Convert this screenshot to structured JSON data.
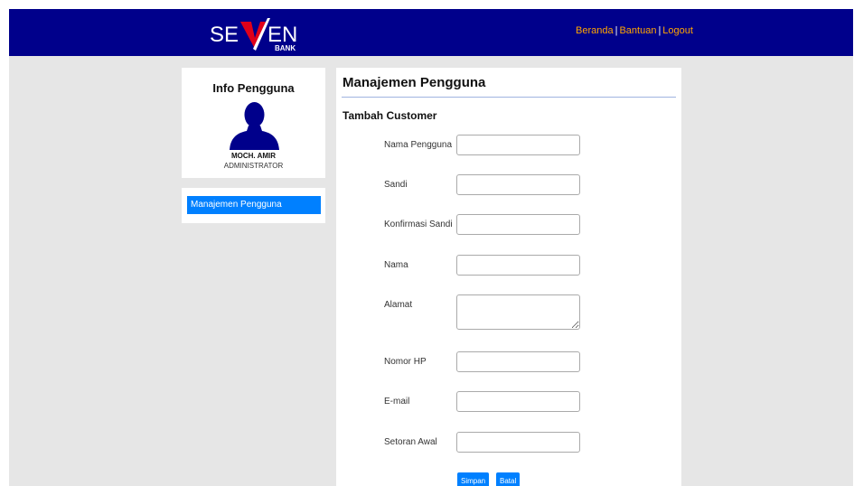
{
  "brand": {
    "logo_text_left": "SE",
    "logo_text_right": "EN",
    "logo_sub": "BANK",
    "header_bg": "#00008b",
    "logo_accent": "#e0001a",
    "link_color": "#ffa500"
  },
  "nav": {
    "items": [
      {
        "label": "Beranda"
      },
      {
        "label": "Bantuan"
      },
      {
        "label": "Logout"
      }
    ],
    "separator": "|"
  },
  "user_panel": {
    "title": "Info Pengguna",
    "avatar_icon": "user-silhouette-icon",
    "name": "MOCH. AMIR",
    "role": "ADMINISTRATOR"
  },
  "menu": {
    "items": [
      {
        "label": "Manajemen Pengguna",
        "active": true
      }
    ]
  },
  "main": {
    "title": "Manajemen Pengguna",
    "subtitle": "Tambah Customer",
    "fields": [
      {
        "label": "Nama Pengguna",
        "value": "",
        "type": "text"
      },
      {
        "label": "Sandi",
        "value": "",
        "type": "password"
      },
      {
        "label": "Konfirmasi Sandi",
        "value": "",
        "type": "password"
      },
      {
        "label": "Nama",
        "value": "",
        "type": "text"
      },
      {
        "label": "Alamat",
        "value": "",
        "type": "textarea"
      },
      {
        "label": "Nomor HP",
        "value": "",
        "type": "text"
      },
      {
        "label": "E-mail",
        "value": "",
        "type": "text"
      },
      {
        "label": "Setoran Awal",
        "value": "",
        "type": "text"
      }
    ],
    "buttons": {
      "save": "Simpan",
      "cancel": "Batal"
    }
  }
}
